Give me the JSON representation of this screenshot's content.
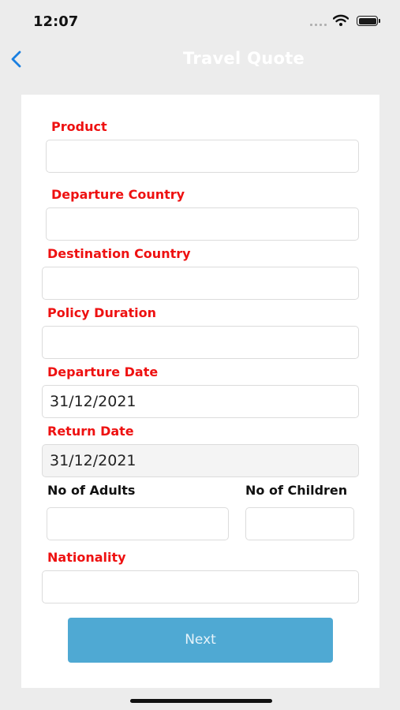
{
  "status_bar": {
    "time": "12:07"
  },
  "nav": {
    "title": "Travel Quote",
    "back_icon": "chevron-left-icon"
  },
  "form": {
    "product": {
      "label": "Product",
      "value": ""
    },
    "departure_country": {
      "label": "Departure Country",
      "value": ""
    },
    "destination_country": {
      "label": "Destination Country",
      "value": ""
    },
    "policy_duration": {
      "label": "Policy Duration",
      "value": ""
    },
    "departure_date": {
      "label": "Departure Date",
      "value": "31/12/2021"
    },
    "return_date": {
      "label": "Return Date",
      "value": "31/12/2021"
    },
    "no_of_adults": {
      "label": "No of Adults",
      "value": ""
    },
    "no_of_children": {
      "label": "No of Children",
      "value": ""
    },
    "nationality": {
      "label": "Nationality",
      "value": ""
    },
    "next_label": "Next"
  },
  "colors": {
    "label_required": "#ee1111",
    "button": "#4fa9d3",
    "back_icon": "#1a7fe0"
  }
}
